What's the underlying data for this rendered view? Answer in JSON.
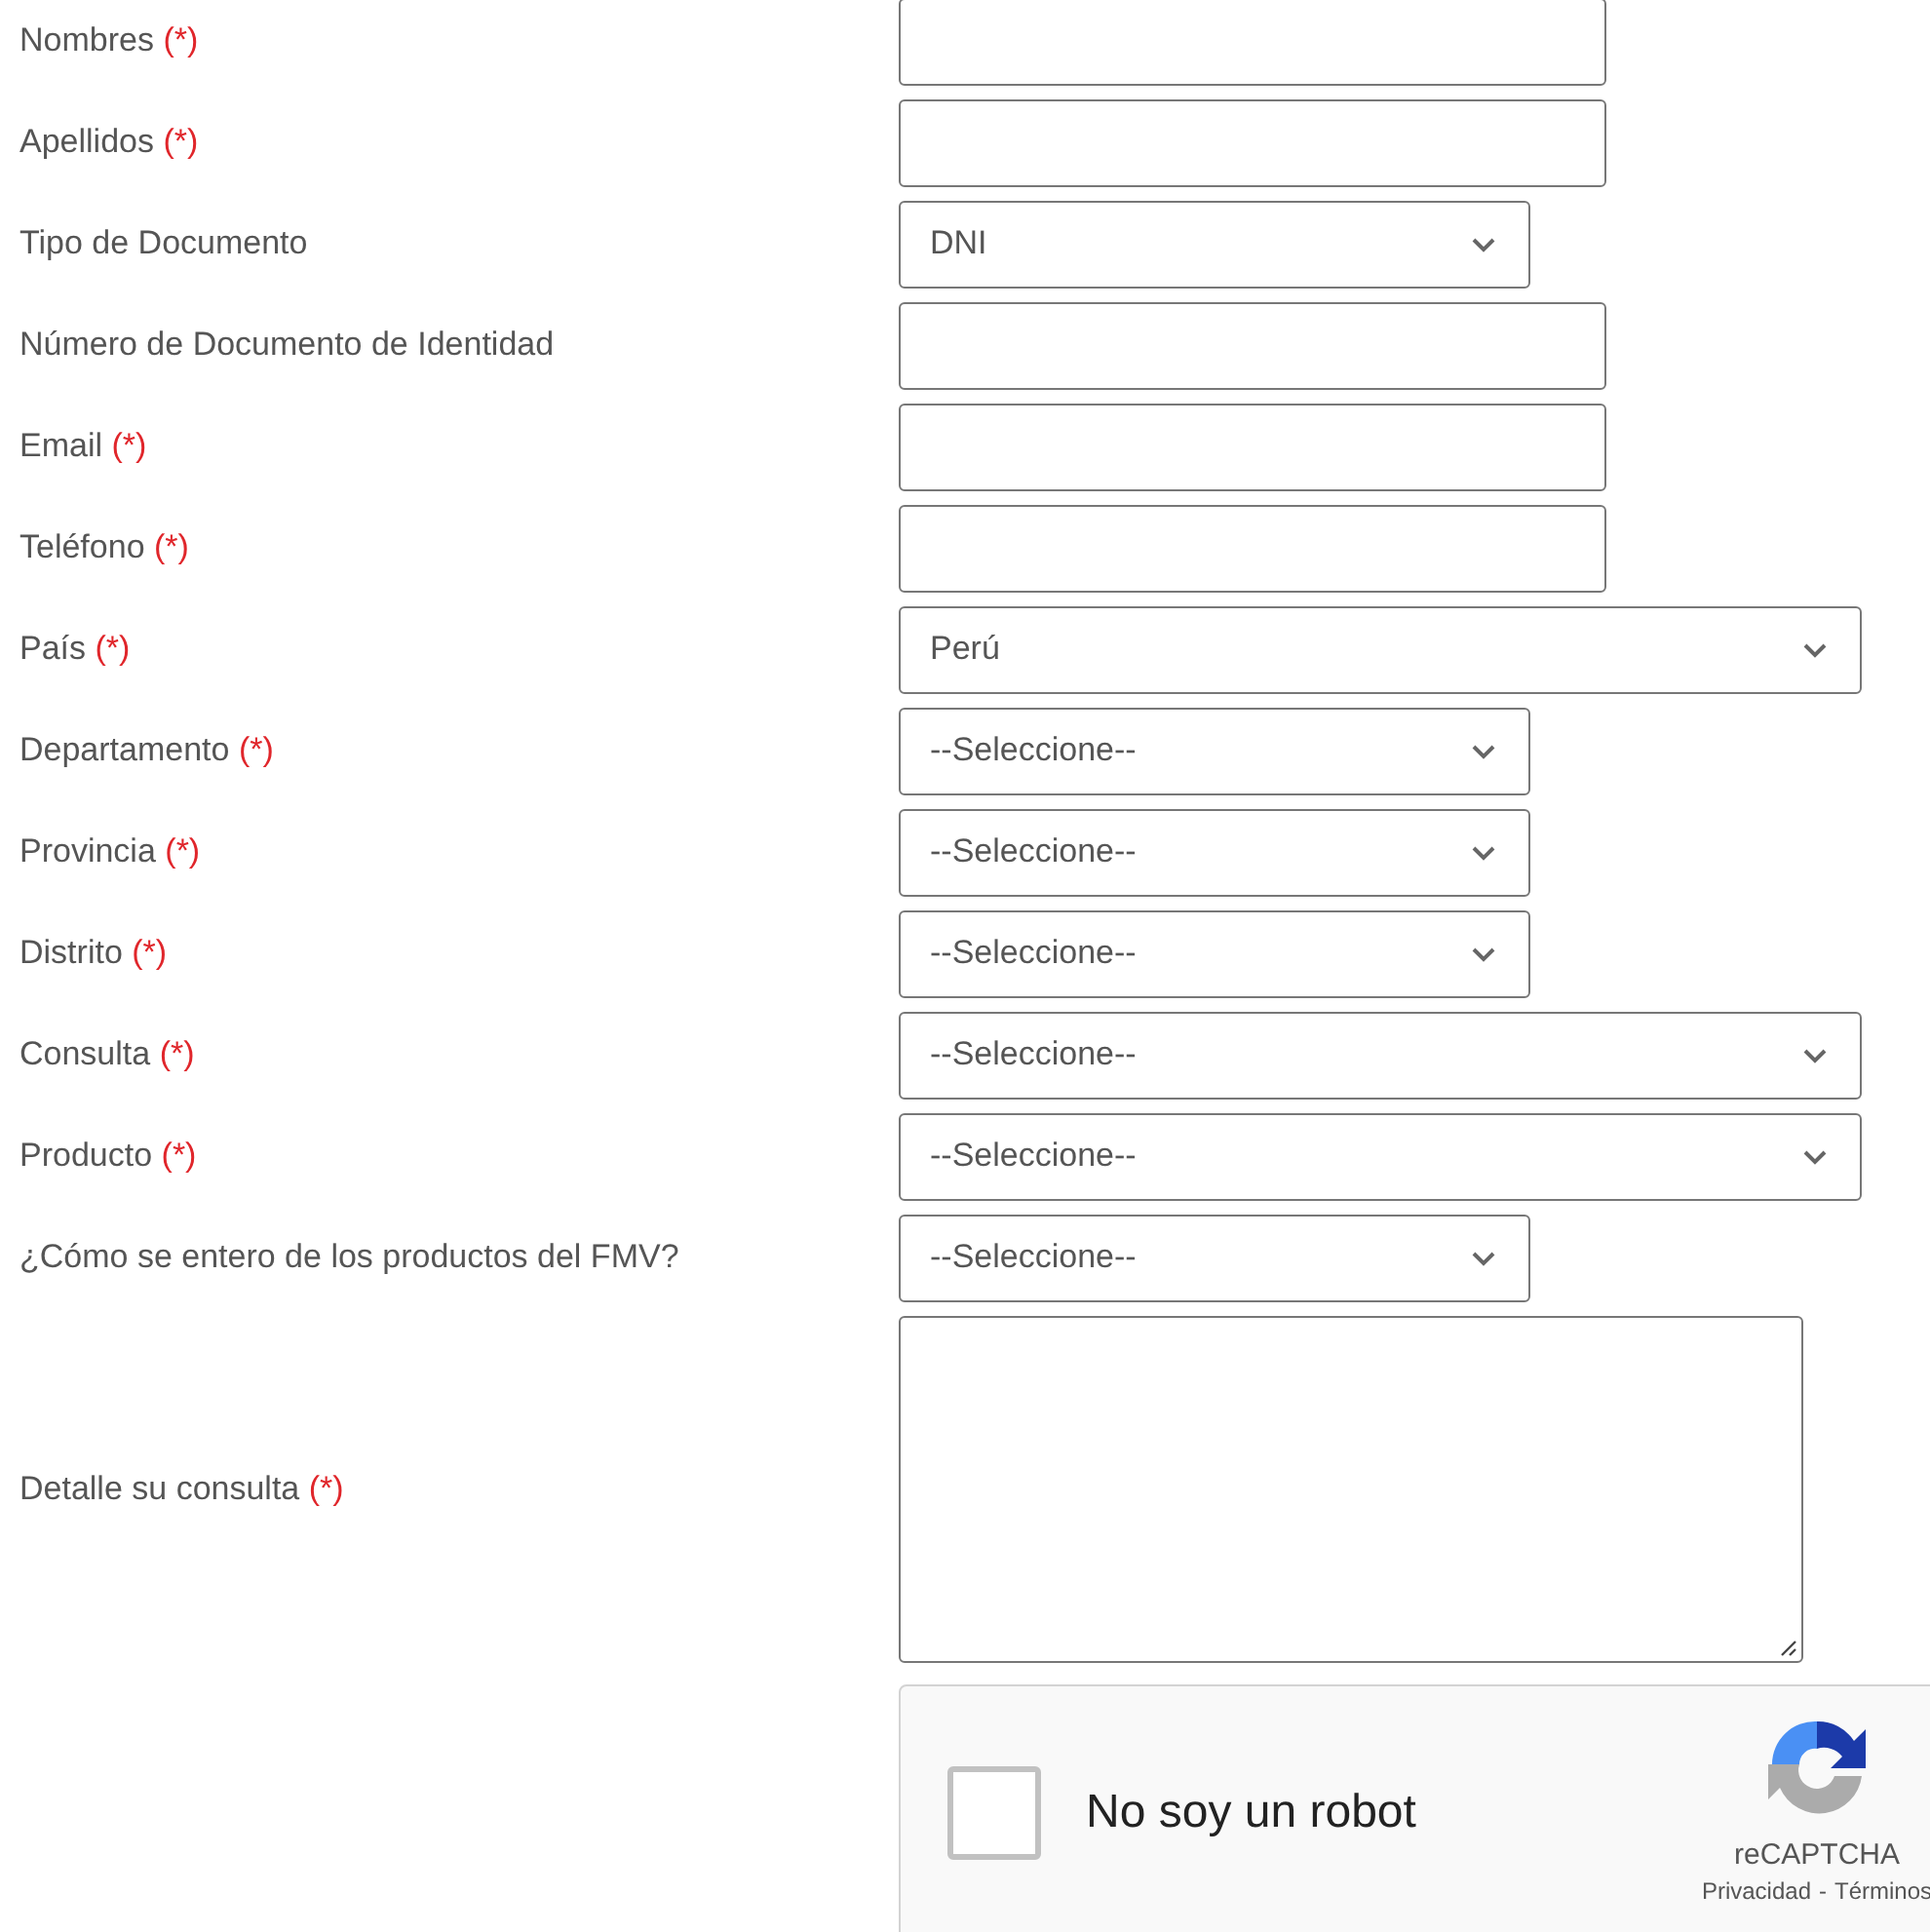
{
  "fields": [
    {
      "label": "Nombres",
      "mark": "(*)",
      "kind": "text"
    },
    {
      "label": "Apellidos",
      "mark": "(*)",
      "kind": "text"
    },
    {
      "label": "Tipo de Documento",
      "kind": "select",
      "wide": false,
      "value": "DNI"
    },
    {
      "label": "Número de Documento de Identidad",
      "kind": "text"
    },
    {
      "label": "Email",
      "mark": "(*)",
      "kind": "text"
    },
    {
      "label": "Teléfono",
      "mark": "(*)",
      "kind": "text"
    },
    {
      "label": "País",
      "mark": "(*)",
      "kind": "select",
      "wide": true,
      "value": "Perú"
    },
    {
      "label": "Departamento",
      "mark": "(*)",
      "kind": "select",
      "wide": false,
      "value": "--Seleccione--"
    },
    {
      "label": "Provincia",
      "mark": "(*)",
      "kind": "select",
      "wide": false,
      "value": "--Seleccione--"
    },
    {
      "label": "Distrito",
      "mark": "(*)",
      "kind": "select",
      "wide": false,
      "value": "--Seleccione--"
    },
    {
      "label": "Consulta",
      "mark": "(*)",
      "kind": "select",
      "wide": true,
      "value": "--Seleccione--"
    },
    {
      "label": "Producto",
      "mark": "(*)",
      "kind": "select",
      "wide": true,
      "value": "--Seleccione--"
    },
    {
      "label": "¿Cómo se entero de los productos del FMV?",
      "kind": "select",
      "wide": false,
      "value": "--Seleccione--"
    },
    {
      "label": "Detalle su consulta",
      "mark": "(*)",
      "kind": "textarea"
    }
  ],
  "captcha": {
    "label": "No soy un robot",
    "checked": false,
    "brand": "reCAPTCHA",
    "links": [
      "Privacidad",
      "Términos"
    ],
    "separator": "-"
  }
}
